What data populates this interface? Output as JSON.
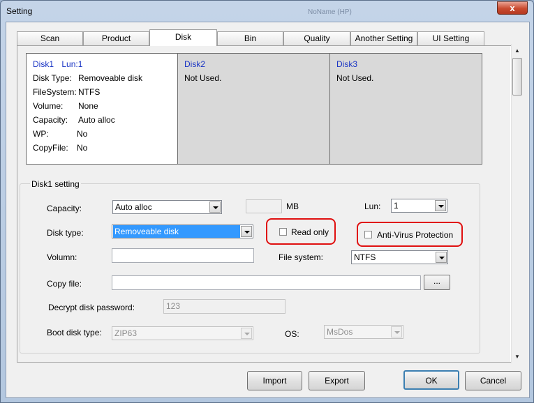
{
  "window": {
    "title": "Setting",
    "ghost_title": "NoName (HP)",
    "close_symbol": "x"
  },
  "tabs": [
    {
      "label": "Scan"
    },
    {
      "label": "Product"
    },
    {
      "label": "Disk",
      "active": true
    },
    {
      "label": "Bin"
    },
    {
      "label": "Quality"
    },
    {
      "label": "Another Setting"
    },
    {
      "label": "UI Setting"
    }
  ],
  "disks": [
    {
      "header": {
        "name": "Disk1",
        "lun": "Lun:1"
      },
      "rows": [
        {
          "key": "Disk Type:",
          "value": "Removeable disk"
        },
        {
          "key": "FileSystem:",
          "value": "NTFS"
        },
        {
          "key": "Volume:",
          "value": "None"
        },
        {
          "key": "Capacity:",
          "value": "Auto alloc"
        },
        {
          "key": "WP:",
          "value": "No"
        },
        {
          "key": "CopyFile:",
          "value": "No"
        }
      ]
    },
    {
      "header": {
        "name": "Disk2"
      },
      "status": "Not Used."
    },
    {
      "header": {
        "name": "Disk3"
      },
      "status": "Not Used."
    }
  ],
  "disk_setting": {
    "group_title": "Disk1 setting",
    "capacity": {
      "label": "Capacity:",
      "value": "Auto alloc",
      "mb_value": "",
      "mb_unit": "MB"
    },
    "lun": {
      "label": "Lun:",
      "value": "1"
    },
    "disk_type": {
      "label": "Disk type:",
      "value": "Removeable disk"
    },
    "read_only": {
      "label": "Read only",
      "checked": false
    },
    "anti_virus": {
      "label": "Anti-Virus Protection",
      "checked": false
    },
    "volumn": {
      "label": "Volumn:",
      "value": ""
    },
    "file_system": {
      "label": "File system:",
      "value": "NTFS"
    },
    "copy_file": {
      "label": "Copy file:",
      "value": "",
      "browse_label": "..."
    },
    "decrypt": {
      "label": "Decrypt disk password:",
      "value": "123"
    },
    "boot_disk": {
      "label": "Boot disk type:",
      "value": "ZIP63"
    },
    "os": {
      "label": "OS:",
      "value": "MsDos"
    }
  },
  "buttons": {
    "import": "Import",
    "export": "Export",
    "ok": "OK",
    "cancel": "Cancel"
  },
  "colors": {
    "highlight": "#e01010",
    "selection": "#3399ff",
    "disk_link": "#1a35c4"
  }
}
